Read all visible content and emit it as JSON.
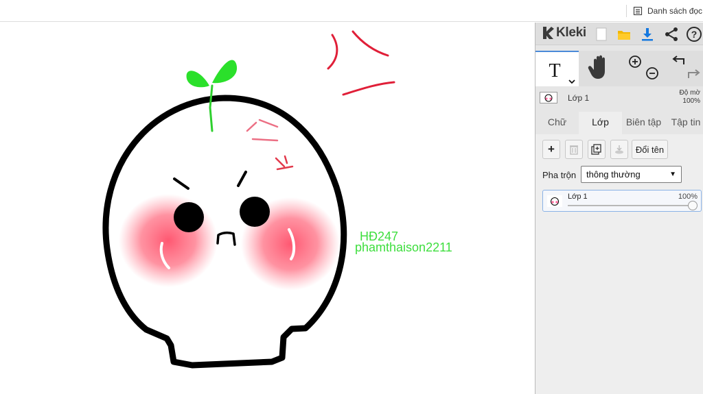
{
  "browser": {
    "reading_list": "Danh sách đọc"
  },
  "canvas": {
    "watermark_line1": "HĐ247",
    "watermark_line2": "phamthaison2211"
  },
  "app": {
    "name": "Kleki",
    "header_icons": [
      "new-image-icon",
      "open-folder-icon",
      "download-icon",
      "share-icon",
      "help-icon"
    ],
    "tools": [
      "text-tool-icon",
      "hand-tool-icon",
      "zoom-in-icon",
      "zoom-out-icon",
      "undo-icon",
      "redo-icon"
    ],
    "current_layer": "Lớp 1",
    "opacity_label_line1": "Độ mờ",
    "opacity_label_line2": "100%",
    "tabs": [
      {
        "label": "Chữ",
        "active": false
      },
      {
        "label": "Lớp",
        "active": true
      },
      {
        "label": "Biên tập",
        "active": false
      },
      {
        "label": "Tập tin",
        "active": false
      }
    ],
    "layer_panel": {
      "add_label": "+",
      "rename_label": "Đổi tên",
      "blend_label": "Pha trộn",
      "blend_value": "thông thường",
      "layers": [
        {
          "name": "Lớp 1",
          "opacity": "100%",
          "opacity_value": 1.0
        }
      ]
    }
  }
}
